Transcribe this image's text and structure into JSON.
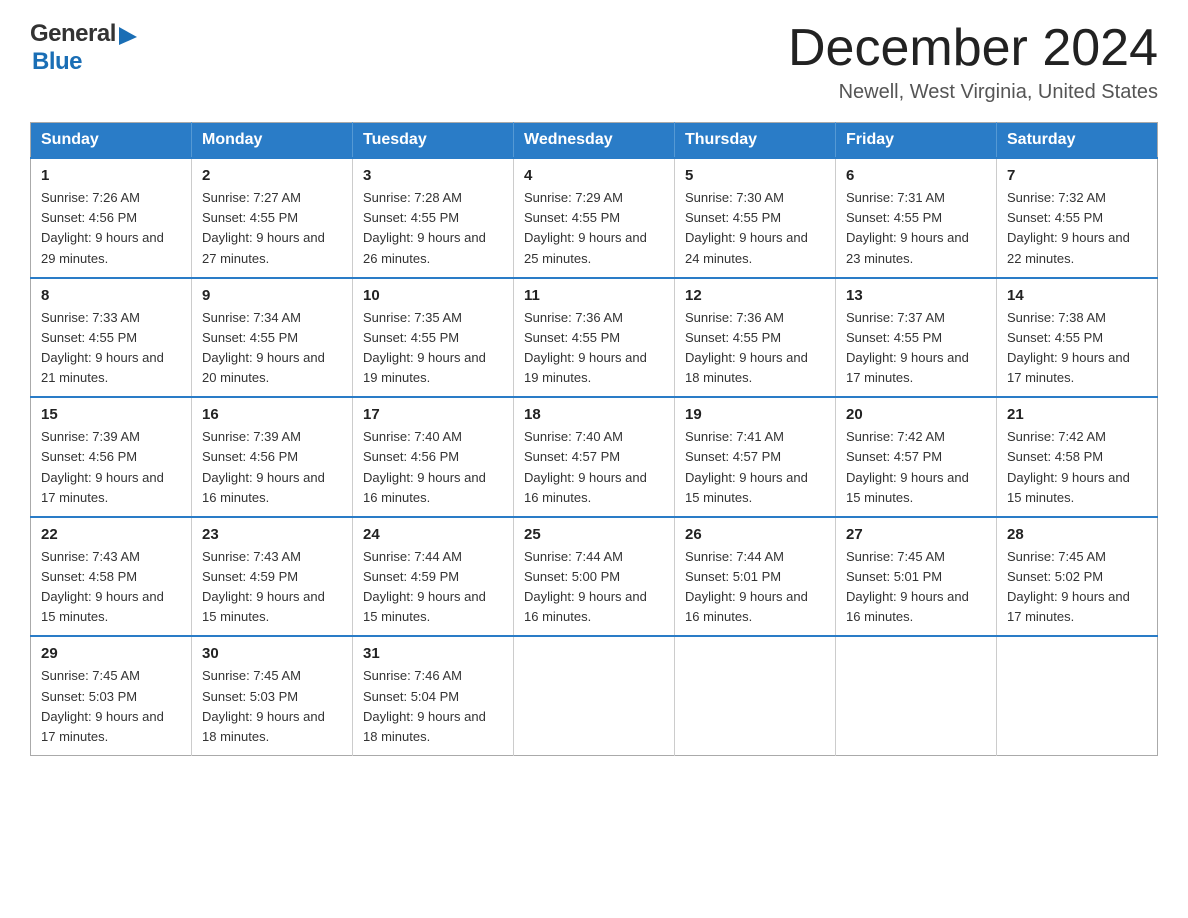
{
  "header": {
    "title": "December 2024",
    "subtitle": "Newell, West Virginia, United States",
    "logo_general": "General",
    "logo_blue": "Blue"
  },
  "calendar": {
    "days_of_week": [
      "Sunday",
      "Monday",
      "Tuesday",
      "Wednesday",
      "Thursday",
      "Friday",
      "Saturday"
    ],
    "weeks": [
      [
        {
          "day": "1",
          "sunrise": "7:26 AM",
          "sunset": "4:56 PM",
          "daylight": "9 hours and 29 minutes."
        },
        {
          "day": "2",
          "sunrise": "7:27 AM",
          "sunset": "4:55 PM",
          "daylight": "9 hours and 27 minutes."
        },
        {
          "day": "3",
          "sunrise": "7:28 AM",
          "sunset": "4:55 PM",
          "daylight": "9 hours and 26 minutes."
        },
        {
          "day": "4",
          "sunrise": "7:29 AM",
          "sunset": "4:55 PM",
          "daylight": "9 hours and 25 minutes."
        },
        {
          "day": "5",
          "sunrise": "7:30 AM",
          "sunset": "4:55 PM",
          "daylight": "9 hours and 24 minutes."
        },
        {
          "day": "6",
          "sunrise": "7:31 AM",
          "sunset": "4:55 PM",
          "daylight": "9 hours and 23 minutes."
        },
        {
          "day": "7",
          "sunrise": "7:32 AM",
          "sunset": "4:55 PM",
          "daylight": "9 hours and 22 minutes."
        }
      ],
      [
        {
          "day": "8",
          "sunrise": "7:33 AM",
          "sunset": "4:55 PM",
          "daylight": "9 hours and 21 minutes."
        },
        {
          "day": "9",
          "sunrise": "7:34 AM",
          "sunset": "4:55 PM",
          "daylight": "9 hours and 20 minutes."
        },
        {
          "day": "10",
          "sunrise": "7:35 AM",
          "sunset": "4:55 PM",
          "daylight": "9 hours and 19 minutes."
        },
        {
          "day": "11",
          "sunrise": "7:36 AM",
          "sunset": "4:55 PM",
          "daylight": "9 hours and 19 minutes."
        },
        {
          "day": "12",
          "sunrise": "7:36 AM",
          "sunset": "4:55 PM",
          "daylight": "9 hours and 18 minutes."
        },
        {
          "day": "13",
          "sunrise": "7:37 AM",
          "sunset": "4:55 PM",
          "daylight": "9 hours and 17 minutes."
        },
        {
          "day": "14",
          "sunrise": "7:38 AM",
          "sunset": "4:55 PM",
          "daylight": "9 hours and 17 minutes."
        }
      ],
      [
        {
          "day": "15",
          "sunrise": "7:39 AM",
          "sunset": "4:56 PM",
          "daylight": "9 hours and 17 minutes."
        },
        {
          "day": "16",
          "sunrise": "7:39 AM",
          "sunset": "4:56 PM",
          "daylight": "9 hours and 16 minutes."
        },
        {
          "day": "17",
          "sunrise": "7:40 AM",
          "sunset": "4:56 PM",
          "daylight": "9 hours and 16 minutes."
        },
        {
          "day": "18",
          "sunrise": "7:40 AM",
          "sunset": "4:57 PM",
          "daylight": "9 hours and 16 minutes."
        },
        {
          "day": "19",
          "sunrise": "7:41 AM",
          "sunset": "4:57 PM",
          "daylight": "9 hours and 15 minutes."
        },
        {
          "day": "20",
          "sunrise": "7:42 AM",
          "sunset": "4:57 PM",
          "daylight": "9 hours and 15 minutes."
        },
        {
          "day": "21",
          "sunrise": "7:42 AM",
          "sunset": "4:58 PM",
          "daylight": "9 hours and 15 minutes."
        }
      ],
      [
        {
          "day": "22",
          "sunrise": "7:43 AM",
          "sunset": "4:58 PM",
          "daylight": "9 hours and 15 minutes."
        },
        {
          "day": "23",
          "sunrise": "7:43 AM",
          "sunset": "4:59 PM",
          "daylight": "9 hours and 15 minutes."
        },
        {
          "day": "24",
          "sunrise": "7:44 AM",
          "sunset": "4:59 PM",
          "daylight": "9 hours and 15 minutes."
        },
        {
          "day": "25",
          "sunrise": "7:44 AM",
          "sunset": "5:00 PM",
          "daylight": "9 hours and 16 minutes."
        },
        {
          "day": "26",
          "sunrise": "7:44 AM",
          "sunset": "5:01 PM",
          "daylight": "9 hours and 16 minutes."
        },
        {
          "day": "27",
          "sunrise": "7:45 AM",
          "sunset": "5:01 PM",
          "daylight": "9 hours and 16 minutes."
        },
        {
          "day": "28",
          "sunrise": "7:45 AM",
          "sunset": "5:02 PM",
          "daylight": "9 hours and 17 minutes."
        }
      ],
      [
        {
          "day": "29",
          "sunrise": "7:45 AM",
          "sunset": "5:03 PM",
          "daylight": "9 hours and 17 minutes."
        },
        {
          "day": "30",
          "sunrise": "7:45 AM",
          "sunset": "5:03 PM",
          "daylight": "9 hours and 18 minutes."
        },
        {
          "day": "31",
          "sunrise": "7:46 AM",
          "sunset": "5:04 PM",
          "daylight": "9 hours and 18 minutes."
        },
        null,
        null,
        null,
        null
      ]
    ]
  }
}
